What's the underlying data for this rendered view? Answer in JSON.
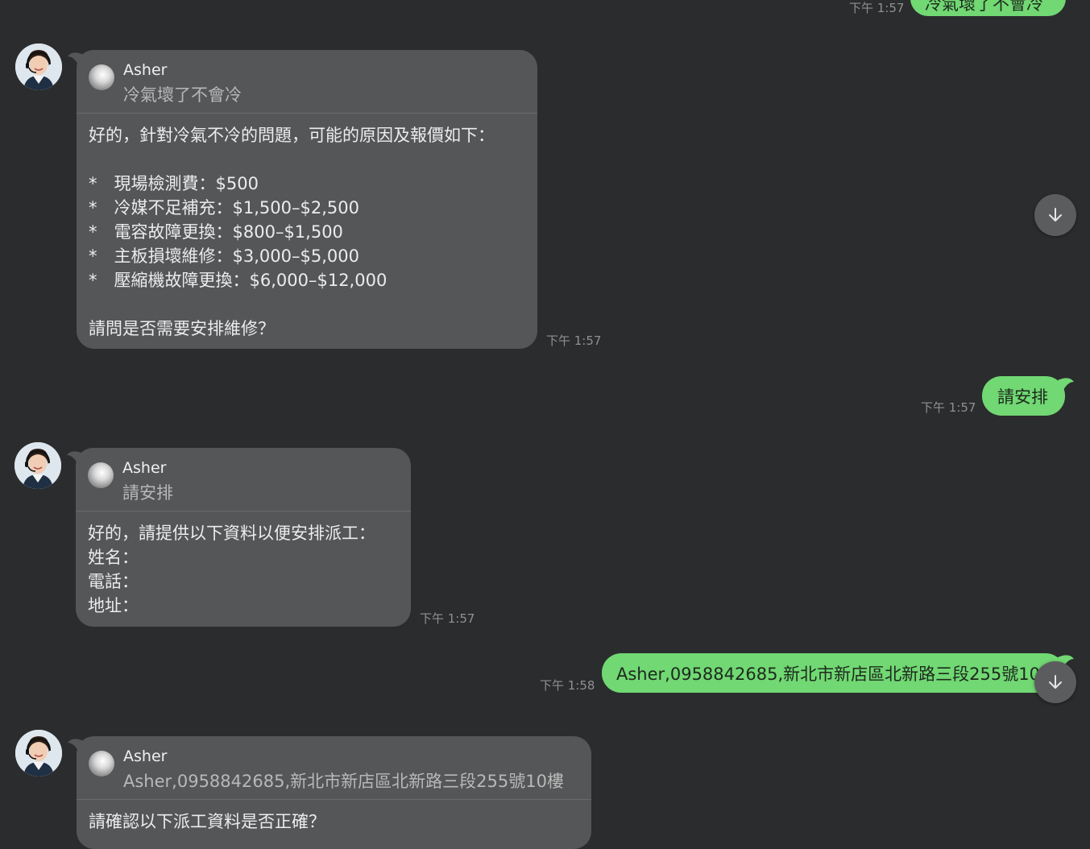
{
  "messages": {
    "top_out": {
      "text": "冷氣壞了不會冷",
      "time": "下午 1:57"
    },
    "m1": {
      "quote_name": "Asher",
      "quote_text": "冷氣壞了不會冷",
      "body": "好的，針對冷氣不冷的問題，可能的原因及報價如下：\n\n*　現場檢測費：$500\n*　冷媒不足補充：$1,500–$2,500\n*　電容故障更換：$800–$1,500\n*　主板損壞維修：$3,000–$5,000\n*　壓縮機故障更換：$6,000–$12,000\n\n請問是否需要安排維修？",
      "time": "下午 1:57"
    },
    "m2_out": {
      "text": "請安排",
      "time": "下午 1:57"
    },
    "m3": {
      "quote_name": "Asher",
      "quote_text": "請安排",
      "body": "好的，請提供以下資料以便安排派工：\n姓名：\n電話：\n地址：",
      "time": "下午 1:57"
    },
    "m4_out": {
      "text": "Asher,0958842685,新北市新店區北新路三段255號10樓",
      "time": "下午 1:58"
    },
    "m5": {
      "quote_name": "Asher",
      "quote_text": "Asher,0958842685,新北市新店區北新路三段255號10樓",
      "body": "請確認以下派工資料是否正確？"
    }
  },
  "colors": {
    "background": "#2b2c2e",
    "incoming": "#555658",
    "outgoing": "#71d873"
  },
  "icons": {
    "scroll_down": "arrow-down-icon"
  }
}
